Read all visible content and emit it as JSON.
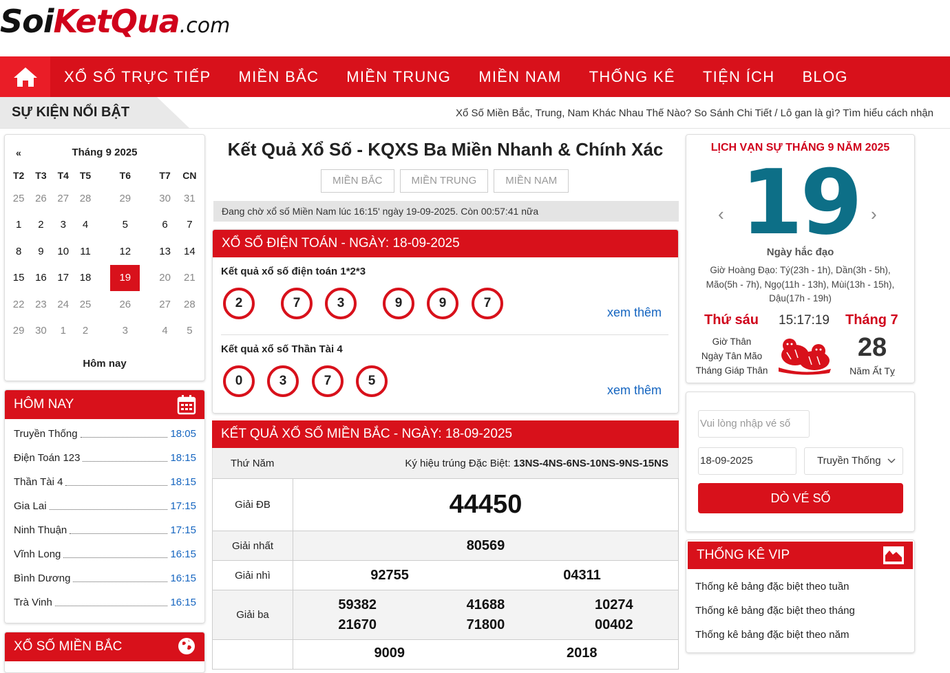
{
  "logo": {
    "part1": "Soi",
    "part2": "KetQua",
    "part3": ".com"
  },
  "nav": {
    "items": [
      "XỔ SỐ TRỰC TIẾP",
      "MIỀN BẮC",
      "MIỀN TRUNG",
      "MIỀN NAM",
      "THỐNG KÊ",
      "TIỆN ÍCH",
      "BLOG"
    ]
  },
  "events": {
    "label": "SỰ KIỆN NỔI BẬT",
    "marquee": "Xổ Số Miền Bắc, Trung, Nam Khác Nhau Thế Nào? So Sánh Chi Tiết / Lô gan là gì? Tìm hiểu cách nhận"
  },
  "calendar": {
    "prev": "«",
    "month": "Tháng 9 2025",
    "days": [
      "T2",
      "T3",
      "T4",
      "T5",
      "T6",
      "T7",
      "CN"
    ],
    "weeks": [
      [
        "25",
        "26",
        "27",
        "28",
        "29",
        "30",
        "31"
      ],
      [
        "1",
        "2",
        "3",
        "4",
        "5",
        "6",
        "7"
      ],
      [
        "8",
        "9",
        "10",
        "11",
        "12",
        "13",
        "14"
      ],
      [
        "15",
        "16",
        "17",
        "18",
        "19",
        "20",
        "21"
      ],
      [
        "22",
        "23",
        "24",
        "25",
        "26",
        "27",
        "28"
      ],
      [
        "29",
        "30",
        "1",
        "2",
        "3",
        "4",
        "5"
      ]
    ],
    "today_label": "Hôm nay"
  },
  "today_box": {
    "title": "HÔM NAY",
    "items": [
      {
        "name": "Truyền Thống",
        "time": "18:05"
      },
      {
        "name": "Điện Toán 123",
        "time": "18:15"
      },
      {
        "name": "Thần Tài 4",
        "time": "18:15"
      },
      {
        "name": "Gia Lai",
        "time": "17:15"
      },
      {
        "name": "Ninh Thuận",
        "time": "17:15"
      },
      {
        "name": "Vĩnh Long",
        "time": "16:15"
      },
      {
        "name": "Bình Dương",
        "time": "16:15"
      },
      {
        "name": "Trà Vinh",
        "time": "16:15"
      }
    ]
  },
  "xsmb_box": {
    "title": "XỔ SỐ MIỀN BẮC"
  },
  "main": {
    "title": "Kết Quả Xổ Số - KQXS Ba Miền Nhanh & Chính Xác",
    "regions": [
      "MIỀN BẮC",
      "MIỀN TRUNG",
      "MIỀN NAM"
    ],
    "wait": "Đang chờ xổ số Miền Nam lúc 16:15' ngày 19-09-2025. Còn 00:57:41 nữa"
  },
  "dientoan": {
    "title": "XỔ SỐ ĐIỆN TOÁN - NGÀY: 18-09-2025",
    "sec1": {
      "label": "Kết quả xổ số điện toán 1*2*3",
      "balls": [
        "2",
        "7",
        "3",
        "9",
        "9",
        "7"
      ]
    },
    "sec2": {
      "label": "Kết quả xổ số Thần Tài 4",
      "balls": [
        "0",
        "3",
        "7",
        "5"
      ]
    },
    "more": "xem thêm"
  },
  "mienbac": {
    "title": "KẾT QUẢ XỔ SỐ MIỀN BẮC - NGÀY: 18-09-2025",
    "day": "Thứ Năm",
    "special_label": "Ký hiệu trúng Đặc Biệt: ",
    "special_code": "13NS-4NS-6NS-10NS-9NS-15NS",
    "g_db": {
      "label": "Giải ĐB",
      "v": "44450"
    },
    "g1": {
      "label": "Giải nhất",
      "v": "80569"
    },
    "g2": {
      "label": "Giải nhì",
      "v": [
        "92755",
        "04311"
      ]
    },
    "g3": {
      "label": "Giải ba",
      "v": [
        "59382",
        "41688",
        "10274",
        "21670",
        "71800",
        "00402"
      ]
    },
    "g4": {
      "v": [
        "9009",
        "2018"
      ]
    }
  },
  "lichvansu": {
    "title": "LỊCH VẠN SỰ THÁNG 9 NĂM 2025",
    "day": "19",
    "day_type": "Ngày hắc đạo",
    "gio": "Giờ Hoàng Đạo: Tý(23h - 1h), Dần(3h - 5h), Mão(5h - 7h), Ngọ(11h - 13h), Mùi(13h - 15h), Dậu(17h - 19h)",
    "weekday": "Thứ sáu",
    "clock": "15:17:19",
    "lunar_month": "Tháng 7",
    "can1": "Giờ Thân",
    "can2": "Ngày Tân Mão",
    "can3": "Tháng Giáp Thân",
    "lunar_day": "28",
    "lunar_year": "Năm Ất Tỵ"
  },
  "dove": {
    "ticket_placeholder": "Vui lòng nhập vé số",
    "date": "18-09-2025",
    "type": "Truyền Thống",
    "button": "DÒ VÉ SỐ"
  },
  "vip": {
    "title": "THỐNG KÊ VIP",
    "items": [
      "Thống kê bảng đặc biệt theo tuần",
      "Thống kê bảng đặc biệt theo tháng",
      "Thống kê bảng đặc biệt theo năm"
    ]
  },
  "colors": {
    "accent": "#d8111b",
    "link": "#1565c0",
    "day_number": "#0d6f87"
  }
}
